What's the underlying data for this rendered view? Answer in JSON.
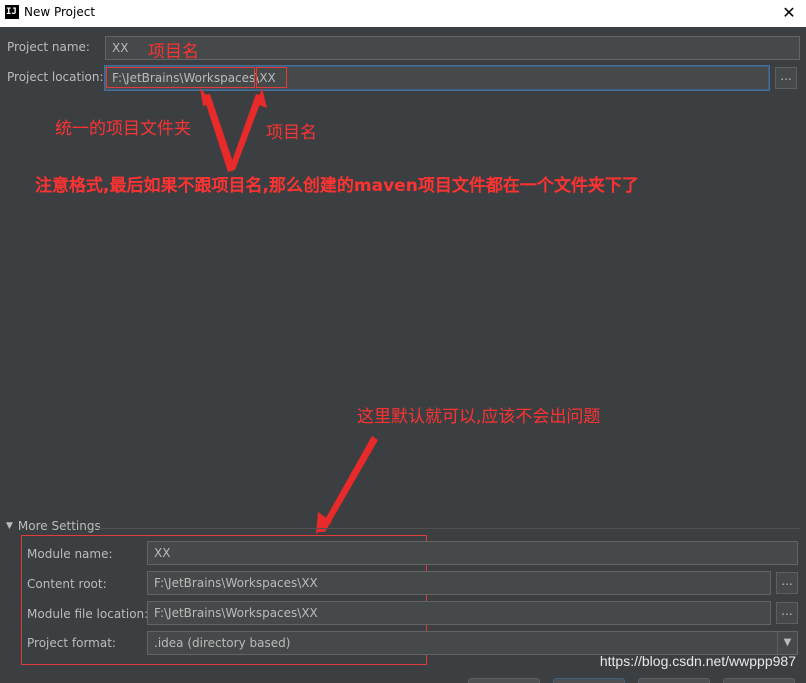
{
  "window": {
    "title": "New Project",
    "app_icon": "IJ",
    "close_glyph": "✕"
  },
  "form": {
    "project_name_label": "Project name:",
    "project_name_value": "XX",
    "project_location_label": "Project location:",
    "project_location_value": "F:\\JetBrains\\Workspaces\\XX",
    "browse_glyph": "..."
  },
  "more_settings": {
    "toggle_label": "More Settings",
    "module_name_label": "Module name:",
    "module_name_value": "XX",
    "content_root_label": "Content root:",
    "content_root_value": "F:\\JetBrains\\Workspaces\\XX",
    "module_file_location_label": "Module file location:",
    "module_file_location_value": "F:\\JetBrains\\Workspaces\\XX",
    "project_format_label": "Project format:",
    "project_format_value": ".idea (directory based)"
  },
  "annotations": {
    "project_name_note": "项目名",
    "unified_folder_note": "统一的项目文件夹",
    "project_name_note2": "项目名",
    "format_note": "注意格式,最后如果不跟项目名,那么创建的maven项目文件都在一个文件夹下了",
    "default_note": "这里默认就可以,应该不会出问题"
  },
  "watermark": "https://blog.csdn.net/wwppp987",
  "colors": {
    "background": "#3c3f41",
    "annotation": "#ff3232",
    "field": "#45494a",
    "focus_border": "#3d6185"
  }
}
